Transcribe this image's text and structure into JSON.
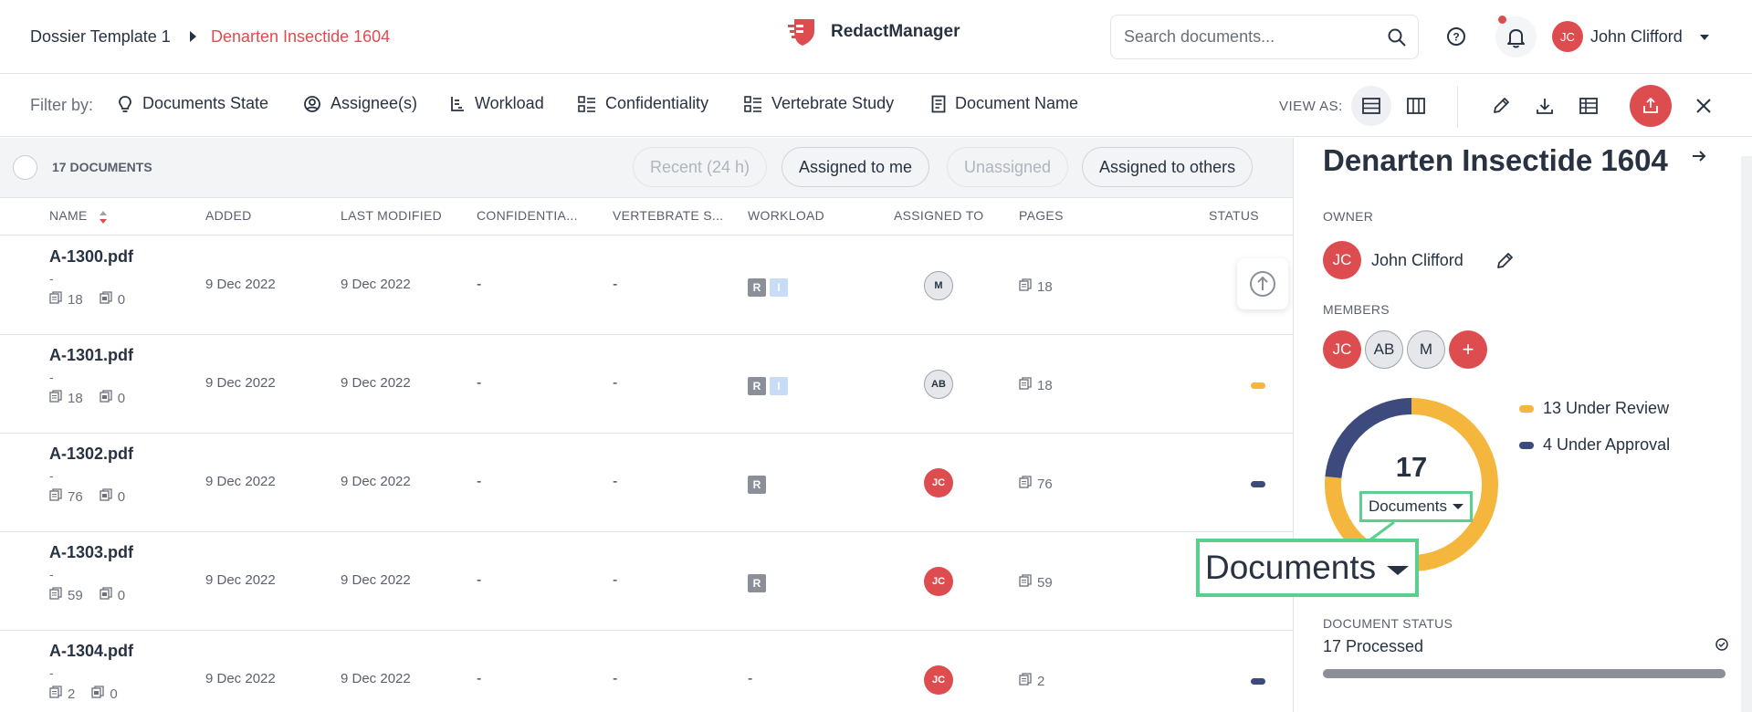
{
  "header": {
    "breadcrumb": [
      "Dossier Template 1",
      "Denarten Insectide 1604"
    ],
    "app_name": "RedactManager",
    "search_placeholder": "Search documents...",
    "user": {
      "initials": "JC",
      "name": "John Clifford"
    }
  },
  "filters": {
    "label": "Filter by:",
    "items": [
      "Documents State",
      "Assignee(s)",
      "Workload",
      "Confidentiality",
      "Vertebrate Study",
      "Document Name"
    ],
    "view_as_label": "VIEW AS:"
  },
  "list": {
    "count_label": "17 DOCUMENTS",
    "quick_filters": [
      "Recent (24 h)",
      "Assigned to me",
      "Unassigned",
      "Assigned to others"
    ],
    "columns": [
      "NAME",
      "ADDED",
      "LAST MODIFIED",
      "CONFIDENTIA...",
      "VERTEBRATE S...",
      "WORKLOAD",
      "ASSIGNED TO",
      "PAGES",
      "STATUS"
    ],
    "rows": [
      {
        "name": "A-1300.pdf",
        "sub": "-",
        "pages_meta": "18",
        "annot": "0",
        "added": "9 Dec 2022",
        "modified": "9 Dec 2022",
        "conf": "-",
        "vert": "-",
        "workload": "RI",
        "assignee": "M",
        "pages": "18",
        "status": ""
      },
      {
        "name": "A-1301.pdf",
        "sub": "-",
        "pages_meta": "18",
        "annot": "0",
        "added": "9 Dec 2022",
        "modified": "9 Dec 2022",
        "conf": "-",
        "vert": "-",
        "workload": "RI",
        "assignee": "AB",
        "pages": "18",
        "status": "#f4b63c"
      },
      {
        "name": "A-1302.pdf",
        "sub": "-",
        "pages_meta": "76",
        "annot": "0",
        "added": "9 Dec 2022",
        "modified": "9 Dec 2022",
        "conf": "-",
        "vert": "-",
        "workload": "R",
        "assignee": "JC",
        "pages": "76",
        "status": "#3c4a7e"
      },
      {
        "name": "A-1303.pdf",
        "sub": "-",
        "pages_meta": "59",
        "annot": "0",
        "added": "9 Dec 2022",
        "modified": "9 Dec 2022",
        "conf": "-",
        "vert": "-",
        "workload": "R",
        "assignee": "JC",
        "pages": "59",
        "status": ""
      },
      {
        "name": "A-1304.pdf",
        "sub": "-",
        "pages_meta": "2",
        "annot": "0",
        "added": "9 Dec 2022",
        "modified": "9 Dec 2022",
        "conf": "-",
        "vert": "-",
        "workload": "-",
        "assignee": "JC",
        "pages": "2",
        "status": "#3c4a7e"
      }
    ]
  },
  "panel": {
    "title": "Denarten Insectide 1604",
    "owner_label": "OWNER",
    "owner": {
      "initials": "JC",
      "name": "John Clifford"
    },
    "members_label": "MEMBERS",
    "members": [
      "JC",
      "AB",
      "M"
    ],
    "add_member": "+",
    "donut": {
      "total": "17",
      "selector": "Documents",
      "segments": [
        {
          "label": "13 Under Review",
          "value": 13,
          "color": "#f4b63c"
        },
        {
          "label": "4 Under Approval",
          "value": 4,
          "color": "#3c4a7e"
        }
      ]
    },
    "doc_status_label": "DOCUMENT STATUS",
    "doc_status_value": "17 Processed",
    "progress": 1.0
  },
  "zoom_callout": {
    "label": "Documents"
  },
  "colors": {
    "accent": "#dd4d50",
    "highlight": "#5ad08e"
  }
}
